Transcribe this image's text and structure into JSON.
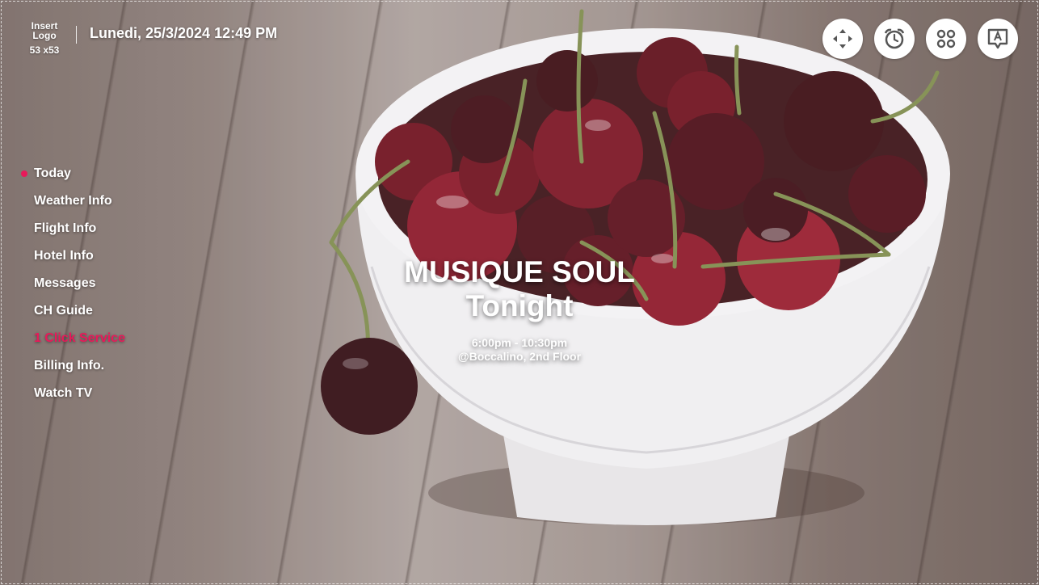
{
  "header": {
    "logo_line1": "Insert",
    "logo_line2": "Logo",
    "logo_size": "53 x53",
    "datetime": "Lunedi, 25/3/2024 12:49 PM"
  },
  "top_icons": [
    {
      "icon": "move-arrows-icon"
    },
    {
      "icon": "alarm-clock-icon"
    },
    {
      "icon": "apps-grid-icon"
    },
    {
      "icon": "message-bubble-icon"
    }
  ],
  "menu": {
    "items": [
      {
        "label": "Today"
      },
      {
        "label": "Weather Info"
      },
      {
        "label": "Flight Info"
      },
      {
        "label": "Hotel Info"
      },
      {
        "label": "Messages"
      },
      {
        "label": "CH Guide"
      },
      {
        "label": "1 Click Service"
      },
      {
        "label": "Billing Info."
      },
      {
        "label": "Watch TV"
      }
    ]
  },
  "promo": {
    "title": "MUSIQUE SOUL",
    "subtitle": "Tonight",
    "time": "6:00pm - 10:30pm",
    "location": "@Boccalino, 2nd Floor"
  },
  "colors": {
    "accent": "#e8195a",
    "icon_gray": "#555555"
  }
}
